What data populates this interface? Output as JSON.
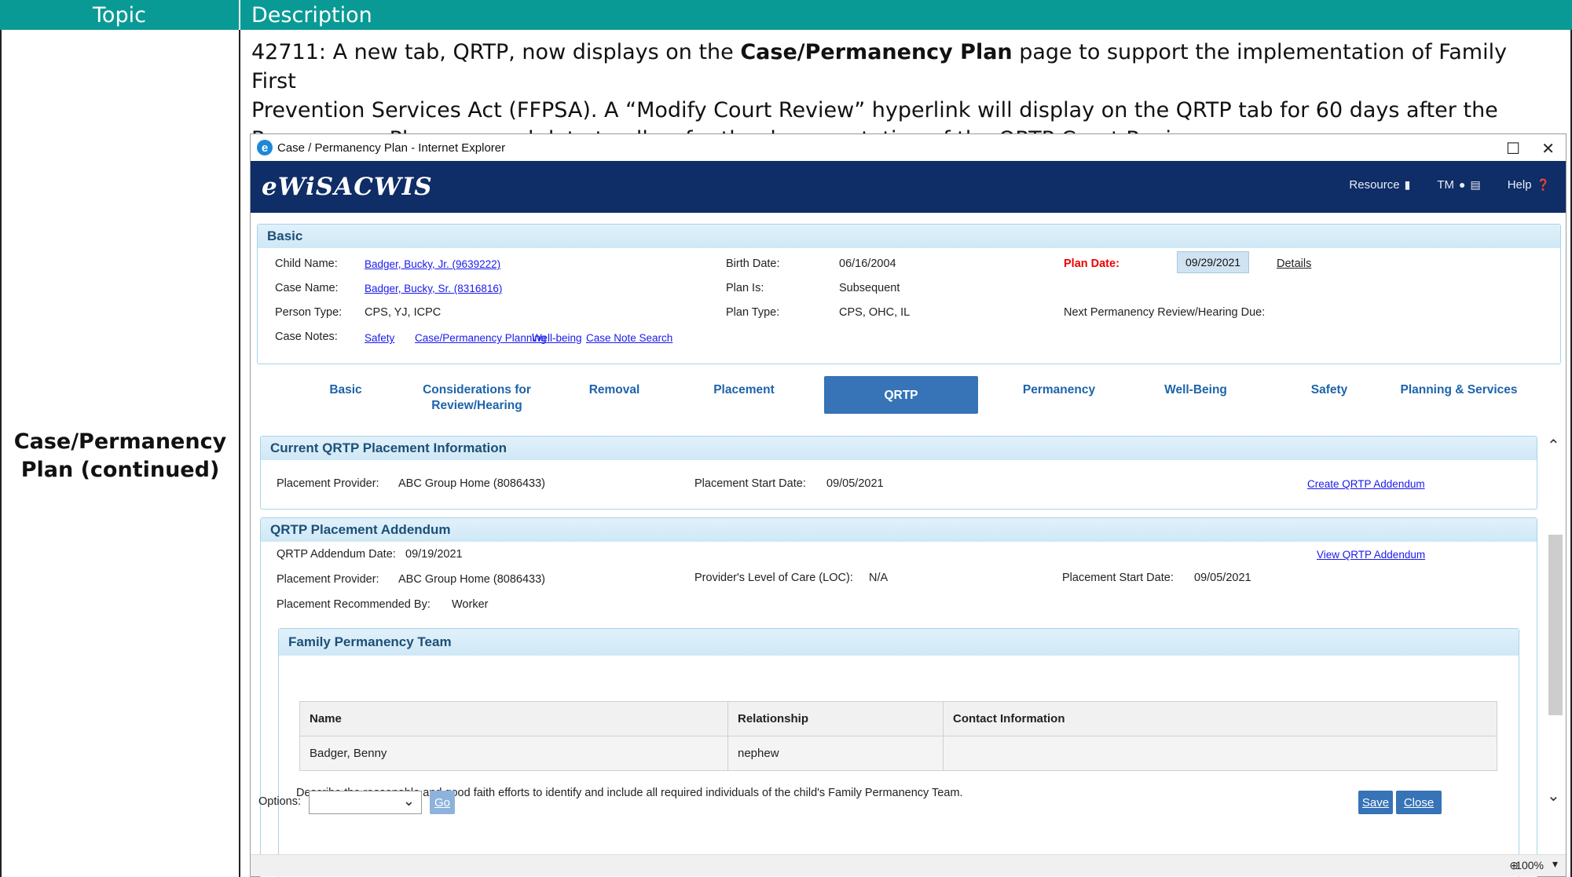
{
  "doc": {
    "topic_header": "Topic",
    "description_header": "Description",
    "topic_line1": "Case/Permanency",
    "topic_line2": "Plan (continued)",
    "desc_p1": "42711: A new tab, QRTP, now displays on the ",
    "desc_bold": "Case/Permanency Plan",
    "desc_p2": " page to support the implementation of Family First",
    "desc_line2": "Prevention Services Act (FFPSA). A “Modify Court Review” hyperlink will display on the QRTP tab for 60 days after the",
    "desc_line3": "Permanency Plan approval date to allow for the documentation of the QRTP Court Review."
  },
  "window": {
    "title": "Case / Permanency Plan - Internet Explorer",
    "maximize": "☐",
    "close": "✕"
  },
  "banner": {
    "brand": "eWiSACWIS",
    "resource": "Resource",
    "tm": "TM",
    "help": "Help"
  },
  "basic": {
    "header": "Basic",
    "child_name_label": "Child Name:",
    "child_name_value": "Badger, Bucky, Jr. (9639222)",
    "case_name_label": "Case Name:",
    "case_name_value": "Badger, Bucky, Sr. (8316816)",
    "person_type_label": "Person Type:",
    "person_type_value": "CPS, YJ, ICPC",
    "case_notes_label": "Case Notes:",
    "case_notes_links": [
      "Safety",
      "Case/Permanency Planning",
      "Well-being",
      "Case Note Search"
    ],
    "birth_date_label": "Birth Date:",
    "birth_date_value": "06/16/2004",
    "plan_is_label": "Plan Is:",
    "plan_is_value": "Subsequent",
    "plan_type_label": "Plan Type:",
    "plan_type_value": "CPS, OHC, IL",
    "plan_date_label": "Plan Date:",
    "plan_date_value": "09/29/2021",
    "details_link": "Details",
    "next_review_label": "Next Permanency Review/Hearing Due:"
  },
  "tabs": {
    "basic": "Basic",
    "considerations_1": "Considerations for",
    "considerations_2": "Review/Hearing",
    "removal": "Removal",
    "placement": "Placement",
    "qrtp": "QRTP",
    "permanency": "Permanency",
    "wellbeing": "Well-Being",
    "safety": "Safety",
    "planning": "Planning & Services"
  },
  "current_qrtp": {
    "header": "Current QRTP Placement Information",
    "provider_label": "Placement Provider:",
    "provider_value": "ABC Group Home  (8086433)",
    "start_label": "Placement Start Date:",
    "start_value": "09/05/2021",
    "create_link": "Create QRTP Addendum"
  },
  "addendum": {
    "header": "QRTP Placement Addendum",
    "date_label": "QRTP Addendum Date:",
    "date_value": "09/19/2021",
    "view_link": "View QRTP Addendum",
    "provider_label": "Placement Provider:",
    "provider_value": "ABC Group Home  (8086433)",
    "loc_label": "Provider's Level of Care (LOC):",
    "loc_value": "N/A",
    "start_label": "Placement Start Date:",
    "start_value": "09/05/2021",
    "recommended_label": "Placement Recommended By:",
    "recommended_value": "Worker"
  },
  "team": {
    "header": "Family Permanency Team",
    "columns": [
      "Name",
      "Relationship",
      "Contact Information"
    ],
    "rows": [
      [
        "Badger, Benny",
        "nephew",
        ""
      ]
    ],
    "describe_text": "Describe the reasonable and good faith efforts to identify and include all required individuals of the child's Family Permanency Team."
  },
  "bottom": {
    "options_label": "Options:",
    "go": "Go",
    "save": "Save",
    "close": "Close",
    "zoom": "100%"
  }
}
